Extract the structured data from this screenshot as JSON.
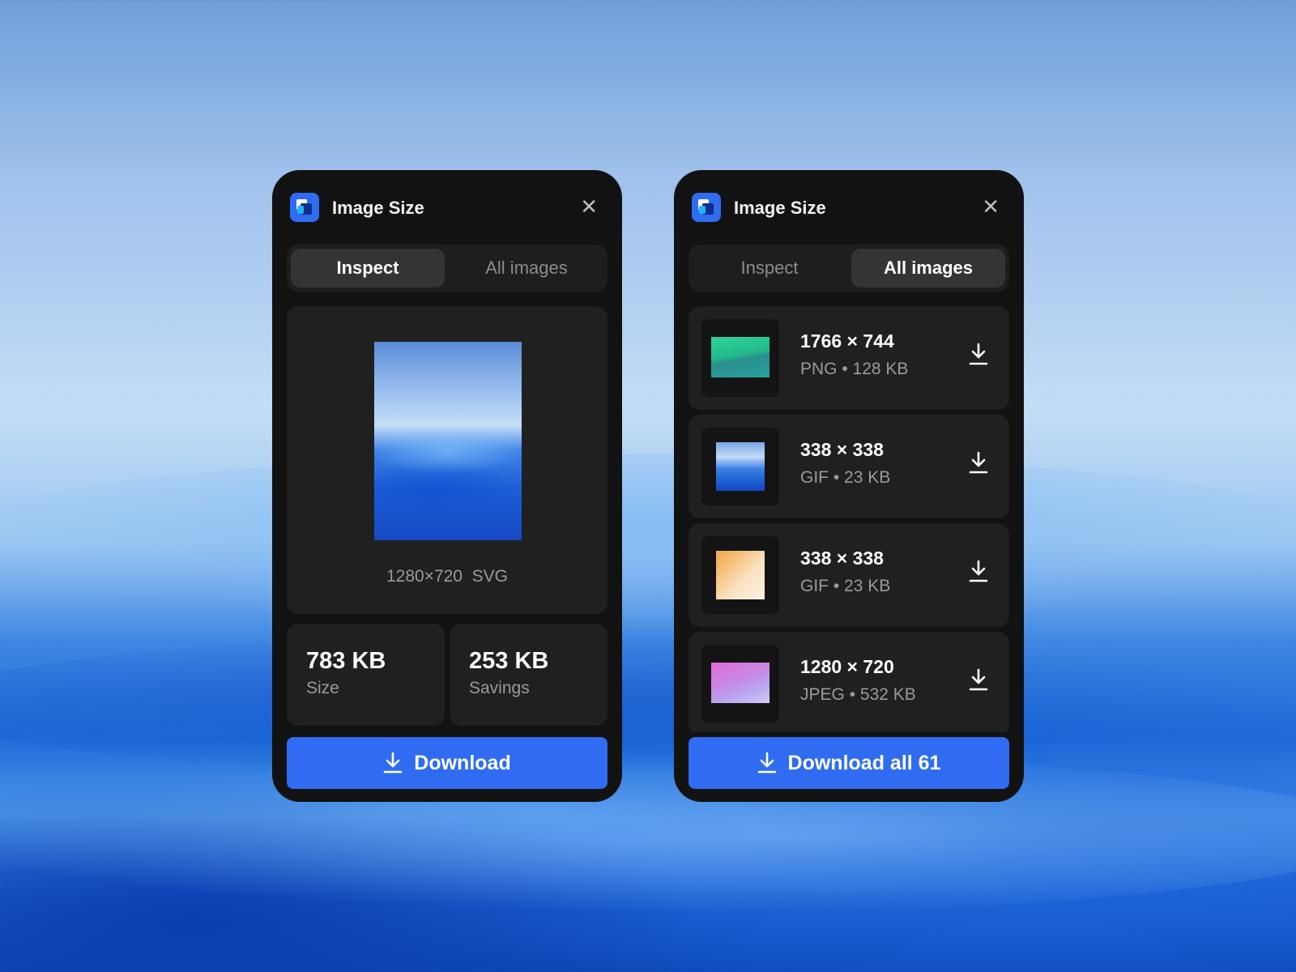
{
  "left_panel": {
    "title": "Image Size",
    "close_symbol": "✕",
    "tabs": [
      {
        "label": "Inspect",
        "active": true
      },
      {
        "label": "All images",
        "active": false
      }
    ],
    "preview": {
      "dimensions": "1280×720",
      "format": "SVG"
    },
    "stats": [
      {
        "value": "783 KB",
        "label": "Size"
      },
      {
        "value": "253 KB",
        "label": "Savings"
      }
    ],
    "download_label": "Download"
  },
  "right_panel": {
    "title": "Image Size",
    "close_symbol": "✕",
    "tabs": [
      {
        "label": "Inspect",
        "active": false
      },
      {
        "label": "All images",
        "active": true
      }
    ],
    "images": [
      {
        "dimensions": "1766 × 744",
        "format": "PNG",
        "size": "128 KB"
      },
      {
        "dimensions": "338 × 338",
        "format": "GIF",
        "size": "23 KB"
      },
      {
        "dimensions": "338 × 338",
        "format": "GIF",
        "size": "23 KB"
      },
      {
        "dimensions": "1280 × 720",
        "format": "JPEG",
        "size": "532 KB"
      }
    ],
    "download_all_label": "Download all 61"
  },
  "colors": {
    "accent": "#2f6cf2",
    "panel_bg": "#121212",
    "card_bg": "#202020",
    "muted_text": "#9a9a9a"
  },
  "icons": [
    "app-logo-icon",
    "close-icon",
    "download-icon"
  ]
}
